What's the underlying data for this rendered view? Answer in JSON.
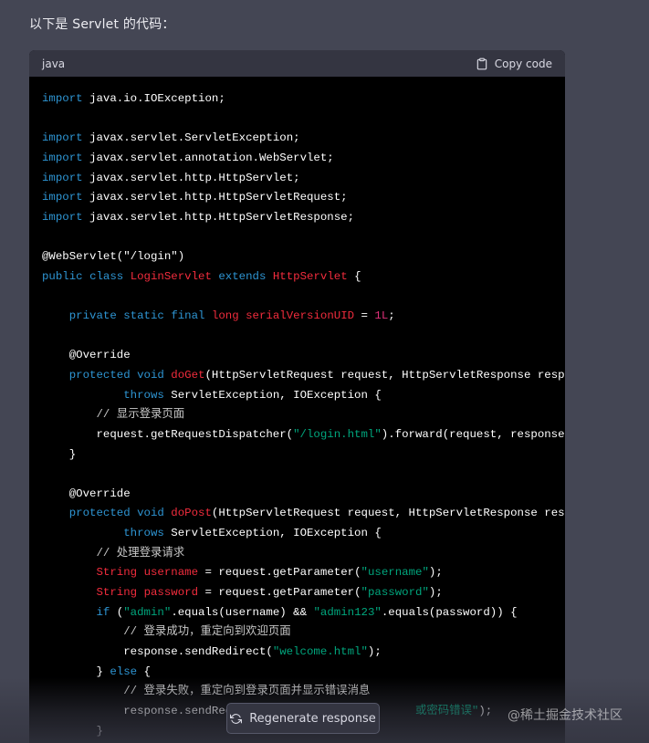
{
  "message": {
    "intro": "以下是 Servlet 的代码："
  },
  "code_block": {
    "language": "java",
    "copy_label": "Copy code",
    "lines": [
      [
        {
          "t": "import",
          "c": "kw"
        },
        {
          "t": " java.io.IOException;"
        }
      ],
      [],
      [
        {
          "t": "import",
          "c": "kw"
        },
        {
          "t": " javax.servlet.ServletException;"
        }
      ],
      [
        {
          "t": "import",
          "c": "kw"
        },
        {
          "t": " javax.servlet.annotation.WebServlet;"
        }
      ],
      [
        {
          "t": "import",
          "c": "kw"
        },
        {
          "t": " javax.servlet.http.HttpServlet;"
        }
      ],
      [
        {
          "t": "import",
          "c": "kw"
        },
        {
          "t": " javax.servlet.http.HttpServletRequest;"
        }
      ],
      [
        {
          "t": "import",
          "c": "kw"
        },
        {
          "t": " javax.servlet.http.HttpServletResponse;"
        }
      ],
      [],
      [
        {
          "t": "@WebServlet(\"/login\")"
        }
      ],
      [
        {
          "t": "public",
          "c": "kw"
        },
        {
          "t": " "
        },
        {
          "t": "class",
          "c": "kw"
        },
        {
          "t": " "
        },
        {
          "t": "LoginServlet",
          "c": "cls"
        },
        {
          "t": " "
        },
        {
          "t": "extends",
          "c": "kw"
        },
        {
          "t": " "
        },
        {
          "t": "HttpServlet",
          "c": "cls"
        },
        {
          "t": " {"
        }
      ],
      [],
      [
        {
          "t": "    "
        },
        {
          "t": "private",
          "c": "kw"
        },
        {
          "t": " "
        },
        {
          "t": "static",
          "c": "kw"
        },
        {
          "t": " "
        },
        {
          "t": "final",
          "c": "kw"
        },
        {
          "t": " "
        },
        {
          "t": "long",
          "c": "cls"
        },
        {
          "t": " "
        },
        {
          "t": "serialVersionUID",
          "c": "cls"
        },
        {
          "t": " = "
        },
        {
          "t": "1L",
          "c": "num"
        },
        {
          "t": ";"
        }
      ],
      [],
      [
        {
          "t": "    @Override"
        }
      ],
      [
        {
          "t": "    "
        },
        {
          "t": "protected",
          "c": "kw"
        },
        {
          "t": " "
        },
        {
          "t": "void",
          "c": "kw"
        },
        {
          "t": " "
        },
        {
          "t": "doGet",
          "c": "cls"
        },
        {
          "t": "(HttpServletRequest request, HttpServletResponse response)"
        }
      ],
      [
        {
          "t": "            "
        },
        {
          "t": "throws",
          "c": "kw"
        },
        {
          "t": " ServletException, IOException {"
        }
      ],
      [
        {
          "t": "        "
        },
        {
          "t": "// 显示登录页面",
          "c": "cmt"
        }
      ],
      [
        {
          "t": "        request.getRequestDispatcher("
        },
        {
          "t": "\"/login.html\"",
          "c": "str"
        },
        {
          "t": ").forward(request, response);"
        }
      ],
      [
        {
          "t": "    }"
        }
      ],
      [],
      [
        {
          "t": "    @Override"
        }
      ],
      [
        {
          "t": "    "
        },
        {
          "t": "protected",
          "c": "kw"
        },
        {
          "t": " "
        },
        {
          "t": "void",
          "c": "kw"
        },
        {
          "t": " "
        },
        {
          "t": "doPost",
          "c": "cls"
        },
        {
          "t": "(HttpServletRequest request, HttpServletResponse response"
        }
      ],
      [
        {
          "t": "            "
        },
        {
          "t": "throws",
          "c": "kw"
        },
        {
          "t": " ServletException, IOException {"
        }
      ],
      [
        {
          "t": "        "
        },
        {
          "t": "// 处理登录请求",
          "c": "cmt"
        }
      ],
      [
        {
          "t": "        "
        },
        {
          "t": "String",
          "c": "cls"
        },
        {
          "t": " "
        },
        {
          "t": "username",
          "c": "cls"
        },
        {
          "t": " = request.getParameter("
        },
        {
          "t": "\"username\"",
          "c": "str"
        },
        {
          "t": ");"
        }
      ],
      [
        {
          "t": "        "
        },
        {
          "t": "String",
          "c": "cls"
        },
        {
          "t": " "
        },
        {
          "t": "password",
          "c": "cls"
        },
        {
          "t": " = request.getParameter("
        },
        {
          "t": "\"password\"",
          "c": "str"
        },
        {
          "t": ");"
        }
      ],
      [
        {
          "t": "        "
        },
        {
          "t": "if",
          "c": "kw"
        },
        {
          "t": " ("
        },
        {
          "t": "\"admin\"",
          "c": "str"
        },
        {
          "t": ".equals(username) && "
        },
        {
          "t": "\"admin123\"",
          "c": "str"
        },
        {
          "t": ".equals(password)) {"
        }
      ],
      [
        {
          "t": "            "
        },
        {
          "t": "// 登录成功，重定向到欢迎页面",
          "c": "cmt"
        }
      ],
      [
        {
          "t": "            response.sendRedirect("
        },
        {
          "t": "\"welcome.html\"",
          "c": "str"
        },
        {
          "t": ");"
        }
      ],
      [
        {
          "t": "        } "
        },
        {
          "t": "else",
          "c": "kw"
        },
        {
          "t": " {"
        }
      ],
      [
        {
          "t": "            "
        },
        {
          "t": "// 登录失败，重定向到登录页面并显示错误消息",
          "c": "cmt"
        }
      ],
      [
        {
          "t": "            response.sendRedi"
        },
        {
          "t": "                          "
        },
        {
          "t": "或密码错误\"",
          "c": "str"
        },
        {
          "t": ");"
        }
      ],
      [
        {
          "t": "        }"
        }
      ]
    ]
  },
  "regenerate": {
    "label": "Regenerate response"
  },
  "watermark": {
    "text": "@稀土掘金技术社区"
  }
}
